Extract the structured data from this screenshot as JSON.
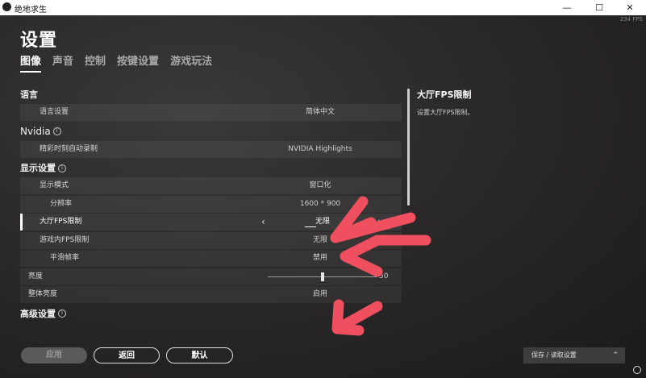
{
  "window": {
    "title": "绝地求生",
    "fps_readout": "234 FPS",
    "minimize": "—",
    "maximize": "☐",
    "close": "✕"
  },
  "page": {
    "title": "设置",
    "tabs": [
      {
        "label": "图像",
        "active": true
      },
      {
        "label": "声音",
        "active": false
      },
      {
        "label": "控制",
        "active": false
      },
      {
        "label": "按键设置",
        "active": false
      },
      {
        "label": "游戏玩法",
        "active": false
      }
    ]
  },
  "settings": {
    "language_section": "语言",
    "language_label": "语言设置",
    "language_value": "简体中文",
    "nvidia_section": "Nvidia",
    "highlights_label": "精彩时刻自动录制",
    "highlights_value": "NVIDIA Highlights",
    "display_section": "显示设置",
    "display_mode_label": "显示模式",
    "display_mode_value": "窗口化",
    "resolution_label": "分辨率",
    "resolution_value": "1600 * 900",
    "lobby_fps_label": "大厅FPS限制",
    "lobby_fps_value": "无限",
    "ingame_fps_label": "游戏内FPS限制",
    "ingame_fps_value": "无限",
    "smoothing_label": "平滑帧率",
    "smoothing_value": "禁用",
    "brightness_label": "亮度",
    "brightness_value": "50",
    "brightness_level": 0.5,
    "overall_brightness_label": "整体亮度",
    "overall_brightness_value": "启用",
    "advanced_section": "高级设置"
  },
  "description": {
    "title": "大厅FPS限制",
    "text": "设置大厅FPS限制。"
  },
  "footer": {
    "apply": "应用",
    "back": "返回",
    "default": "默认",
    "save_load": "保存 / 读取设置"
  },
  "colors": {
    "annotation": "#f04f5f",
    "accent": "#ffffff"
  }
}
